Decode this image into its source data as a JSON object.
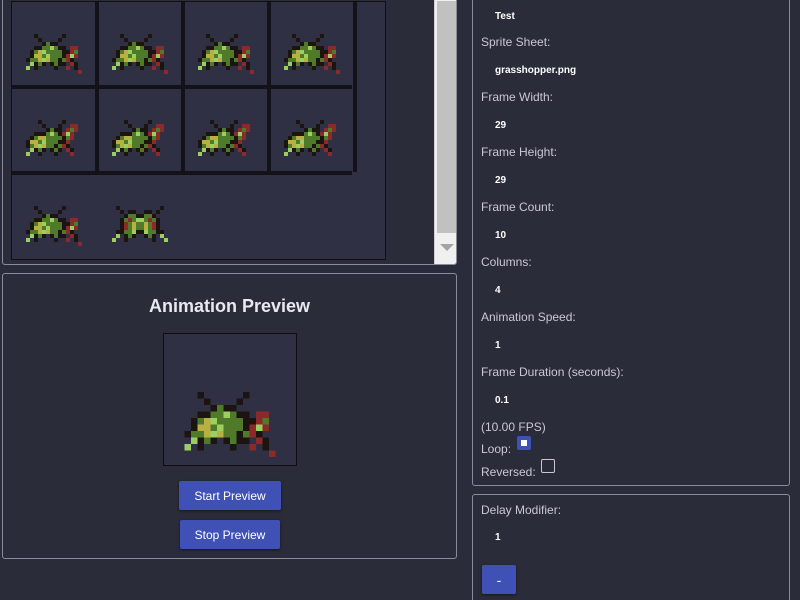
{
  "sprite_sheet": {
    "columns": 4,
    "rows": 3
  },
  "preview": {
    "title": "Animation Preview",
    "start_label": "Start Preview",
    "stop_label": "Stop Preview"
  },
  "properties": {
    "name_value": "Test",
    "sprite_sheet_label": "Sprite Sheet:",
    "sprite_sheet_value": "grasshopper.png",
    "frame_width_label": "Frame Width:",
    "frame_width_value": "29",
    "frame_height_label": "Frame Height:",
    "frame_height_value": "29",
    "frame_count_label": "Frame Count:",
    "frame_count_value": "10",
    "columns_label": "Columns:",
    "columns_value": "4",
    "speed_label": "Animation Speed:",
    "speed_value": "1",
    "duration_label": "Frame Duration (seconds):",
    "duration_value": "0.1",
    "fps_text": "(10.00 FPS)",
    "loop_label": "Loop:",
    "loop_checked": true,
    "reversed_label": "Reversed:",
    "reversed_checked": false
  },
  "delay": {
    "label": "Delay Modifier:",
    "value": "1",
    "minus_label": "-"
  },
  "colors": {
    "background": "#2b2c3a",
    "panel_border": "#8a8c9e",
    "button": "#3f51b5",
    "sprite_dark": "#1b1410",
    "sprite_green": "#4f7a2a",
    "sprite_light": "#9bd060",
    "sprite_yellow": "#b8b040",
    "sprite_red": "#8c2a2a"
  }
}
